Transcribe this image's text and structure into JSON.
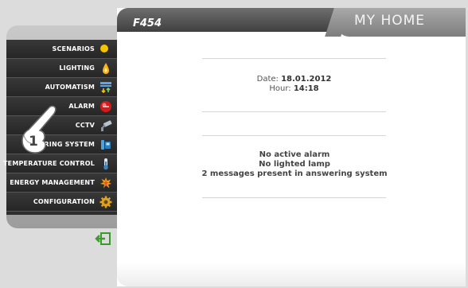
{
  "device_title": "F454",
  "brand": "MY HOME",
  "menu": {
    "items": [
      {
        "label": "SCENARIOS",
        "icon": "scenarios-icon"
      },
      {
        "label": "LIGHTING",
        "icon": "lighting-icon"
      },
      {
        "label": "AUTOMATISM",
        "icon": "automatism-icon"
      },
      {
        "label": "ALARM",
        "icon": "alarm-icon"
      },
      {
        "label": "CCTV",
        "icon": "cctv-icon"
      },
      {
        "label": "RING SYSTEM",
        "icon": "answering-system-icon"
      },
      {
        "label": "TEMPERATURE CONTROL",
        "icon": "thermometer-icon"
      },
      {
        "label": "ENERGY MANAGEMENT",
        "icon": "energy-icon"
      },
      {
        "label": "CONFIGURATION",
        "icon": "gear-icon"
      }
    ]
  },
  "info": {
    "date_label": "Date:",
    "date_value": "18.01.2012",
    "hour_label": "Hour:",
    "hour_value": "14:18"
  },
  "status": {
    "alarm": "No active alarm",
    "lamp": "No lighted lamp",
    "messages": "2 messages present in answering system"
  },
  "overlay": {
    "step_number": "1"
  }
}
